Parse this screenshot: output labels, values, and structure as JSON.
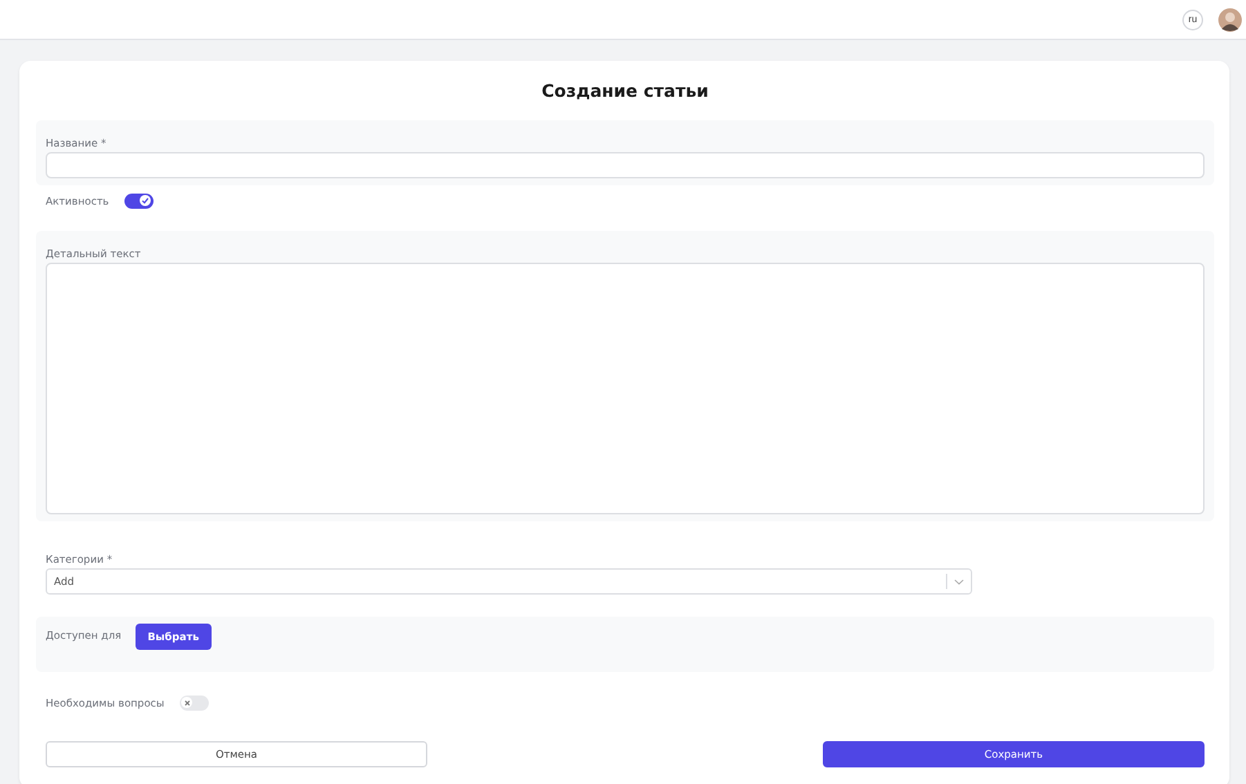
{
  "header": {
    "language": "ru"
  },
  "title": "Создание статьи",
  "name_field": {
    "label": "Название *"
  },
  "active_toggle": {
    "label": "Активность",
    "on": true
  },
  "detail_field": {
    "label": "Детальный текст"
  },
  "categories": {
    "label": "Категории *",
    "placeholder": "Add"
  },
  "available_for": {
    "label": "Доступен для",
    "button": "Выбрать"
  },
  "questions_toggle": {
    "label": "Необходимы вопросы",
    "on": false
  },
  "buttons": [
    {
      "label": "Отмена",
      "kind": "secondary"
    },
    {
      "label": "Сохранить",
      "kind": "primary"
    }
  ]
}
